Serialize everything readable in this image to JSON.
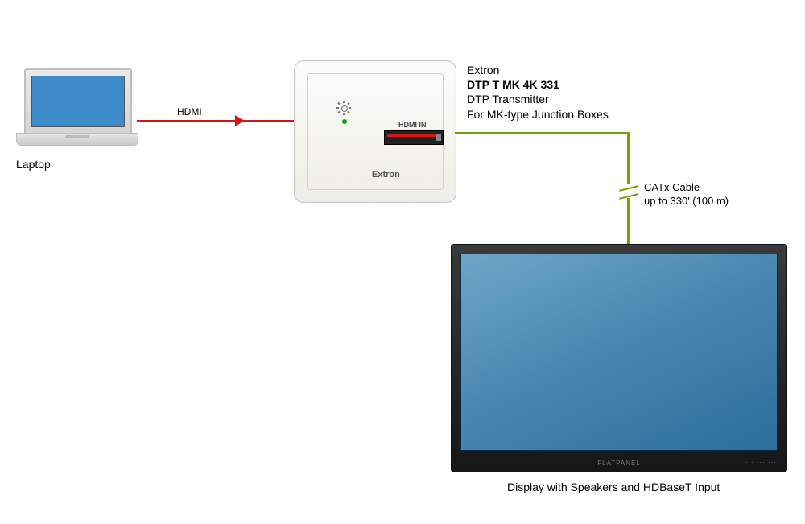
{
  "laptop": {
    "label": "Laptop"
  },
  "cables": {
    "hdmi_label": "HDMI",
    "catx_line1": "CATx Cable",
    "catx_line2": "up to 330' (100 m)"
  },
  "plate": {
    "port_label": "HDMI IN",
    "logo": "Extron"
  },
  "product": {
    "brand": "Extron",
    "model": "DTP T MK 4K 331",
    "line1": "DTP Transmitter",
    "line2": "For MK-type Junction Boxes"
  },
  "display": {
    "caption": "Display with Speakers and HDBaseT Input"
  }
}
